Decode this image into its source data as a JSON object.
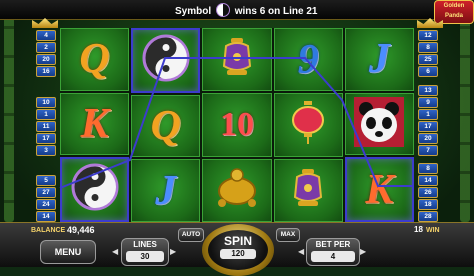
{
  "topbar": {
    "msg_before": "Symbol",
    "msg_after": "wins 6 on Line 21",
    "logo_line1": "Golden",
    "logo_line2": "Panda"
  },
  "paylines": {
    "left": [
      "4",
      "2",
      "20",
      "16",
      "10",
      "1",
      "11",
      "17",
      "3",
      "5",
      "27",
      "24",
      "14"
    ],
    "right": [
      "12",
      "8",
      "25",
      "6",
      "13",
      "9",
      "1",
      "17",
      "20",
      "7",
      "8",
      "14",
      "26",
      "18",
      "28"
    ]
  },
  "reels": [
    [
      "Q",
      "K",
      "yinyang"
    ],
    [
      "yinyang",
      "Q",
      "J"
    ],
    [
      "vase",
      "10",
      "turtle"
    ],
    [
      "9",
      "lantern",
      "vase"
    ],
    [
      "J",
      "panda",
      "K"
    ]
  ],
  "highlight_cells": [
    [
      0,
      2
    ],
    [
      1,
      0
    ],
    [
      4,
      2
    ]
  ],
  "winning_line": 21,
  "bottom": {
    "balance_label": "BALANCE",
    "balance_value": "49,446",
    "win_lines_value": "18",
    "win_lines_label": "WIN",
    "menu_label": "MENU",
    "lines_label": "LINES",
    "lines_value": "30",
    "auto_label": "AUTO",
    "spin_label": "SPIN",
    "spin_value": "120",
    "max_label": "MAX",
    "betper_label": "BET PER",
    "betper_value": "4"
  },
  "colors": {
    "gold": "#f5d36a",
    "reel_green": "#1c6a18",
    "payline_blue": "#3c3ccd"
  }
}
